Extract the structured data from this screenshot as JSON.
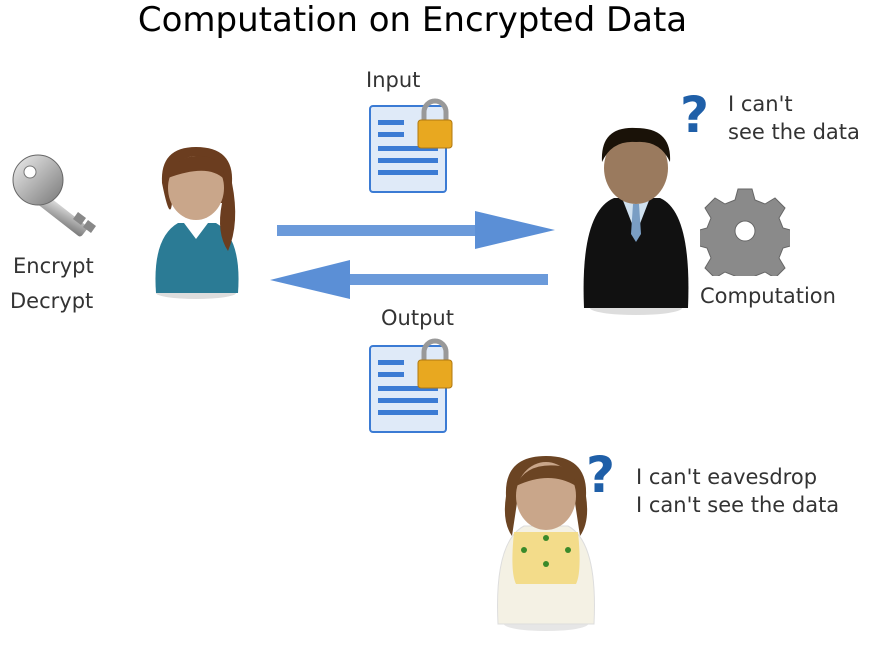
{
  "title": "Computation on Encrypted Data",
  "client": {
    "key_labels": [
      "Encrypt",
      "Decrypt"
    ]
  },
  "messages": {
    "input_label": "Input",
    "output_label": "Output"
  },
  "server": {
    "thought_lines": [
      "I can't",
      "see the data"
    ],
    "computation_label": "Computation"
  },
  "eavesdropper": {
    "thought_lines": [
      "I can't eavesdrop",
      "I can't see the data"
    ]
  },
  "colors": {
    "arrow": "#5b8fd6",
    "question": "#1f5fa8",
    "document": "#3b7bd4"
  }
}
